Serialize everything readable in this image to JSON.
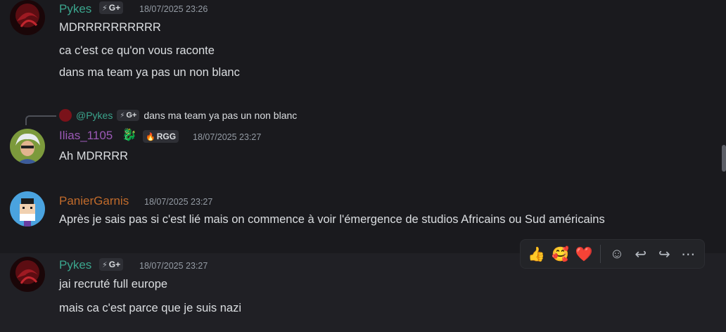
{
  "messages": [
    {
      "author": "Pykes",
      "author_color": "#3ba58d",
      "badge": "G+",
      "timestamp": "18/07/2025 23:26",
      "lines": [
        "MDRRRRRRRRRR",
        "ca c'est ce qu'on vous raconte",
        "dans ma team ya pas un non blanc"
      ]
    },
    {
      "reply": {
        "mention": "@Pykes",
        "badge": "G+",
        "text": "dans ma team ya pas un non blanc"
      },
      "author": "Ilias_1105",
      "author_color": "#9b59b6",
      "emoji": "🐉",
      "badge": "RGG",
      "timestamp": "18/07/2025 23:27",
      "lines": [
        "Ah MDRRRR"
      ]
    },
    {
      "author": "PanierGarnis",
      "author_color": "#c16b2b",
      "timestamp": "18/07/2025 23:27",
      "lines": [
        "Après je sais pas si c'est lié mais on commence à voir l'émergence de studios Africains ou Sud américains"
      ]
    },
    {
      "author": "Pykes",
      "author_color": "#3ba58d",
      "badge": "G+",
      "timestamp": "18/07/2025 23:27",
      "lines": [
        "jai recruté full europe",
        "mais ca c'est parce que je suis nazi"
      ]
    }
  ],
  "toolbar": {
    "reactions": [
      {
        "name": "thumbs-up",
        "glyph": "👍"
      },
      {
        "name": "smiling-face-with-hearts",
        "glyph": "🥰"
      },
      {
        "name": "red-heart",
        "glyph": "❤️"
      }
    ],
    "actions": [
      {
        "name": "add-reaction-icon",
        "glyph": "☺"
      },
      {
        "name": "reply-icon",
        "glyph": "↩"
      },
      {
        "name": "forward-icon",
        "glyph": "↪"
      },
      {
        "name": "more-icon",
        "glyph": "⋯"
      }
    ]
  }
}
